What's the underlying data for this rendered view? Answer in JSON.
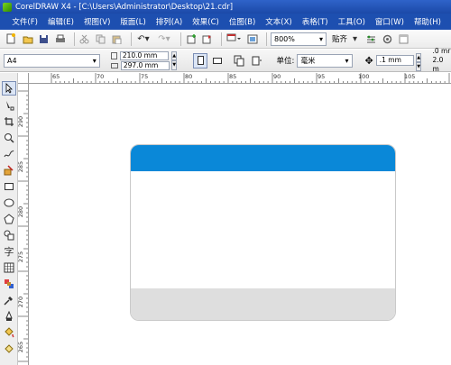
{
  "window": {
    "title": "CorelDRAW X4 - [C:\\Users\\Administrator\\Desktop\\21.cdr]"
  },
  "menu": [
    "文件(F)",
    "编辑(E)",
    "视图(V)",
    "版面(L)",
    "排列(A)",
    "效果(C)",
    "位图(B)",
    "文本(X)",
    "表格(T)",
    "工具(O)",
    "窗口(W)",
    "帮助(H)"
  ],
  "toolbar": {
    "zoom": "800%",
    "snap_label": "贴齐"
  },
  "property_bar": {
    "paper_size": "A4",
    "width": "210.0 mm",
    "height": "297.0 mm",
    "units_label": "单位:",
    "units_value": "毫米",
    "nudge": ".1 mm",
    "dup_x": ".0 mr",
    "dup_y": "2.0 m"
  },
  "ruler": {
    "h_labels": [
      "65",
      "70",
      "75",
      "80",
      "85",
      "90",
      "95",
      "100",
      "105"
    ],
    "v_labels": [
      "290",
      "285",
      "280",
      "275",
      "270",
      "265"
    ]
  },
  "colors": {
    "card_header": "#0a88d8",
    "card_footer": "#dedede",
    "title_bar": "#1b49a8"
  }
}
